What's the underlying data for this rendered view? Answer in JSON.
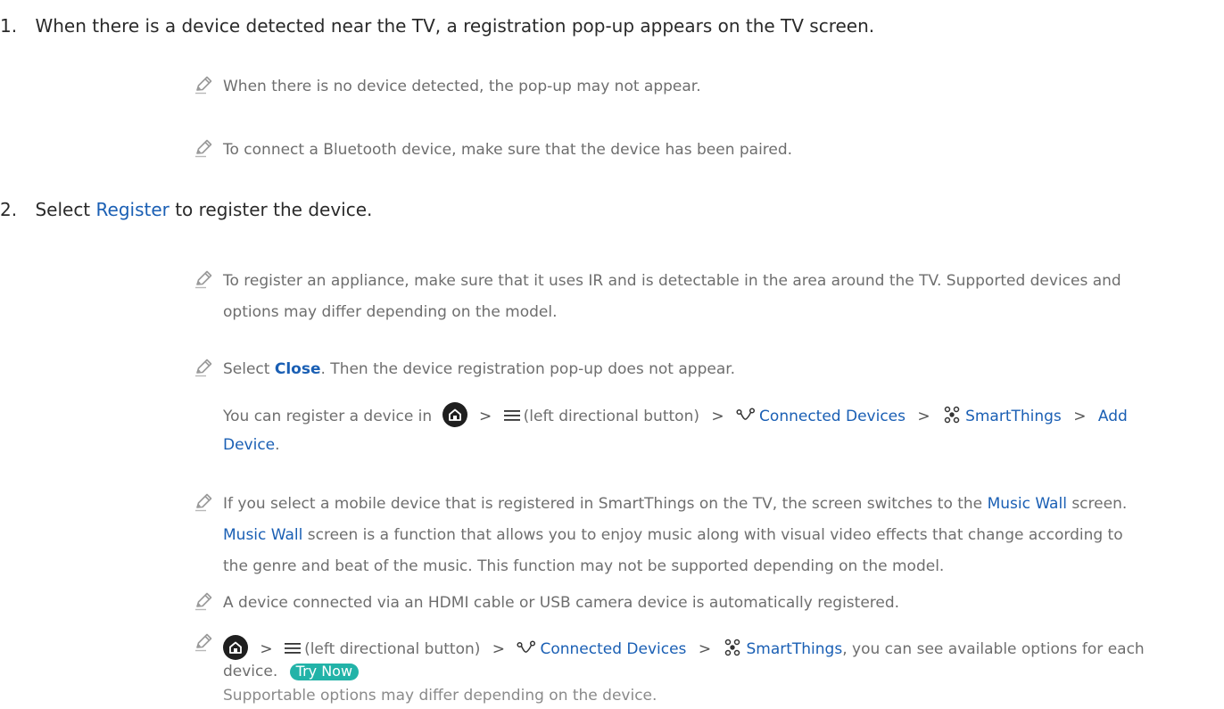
{
  "steps": [
    {
      "number": "1.",
      "text": "When there is a device detected near the TV, a registration pop-up appears on the TV screen."
    },
    {
      "number": "2.",
      "prefix": "Select ",
      "link": "Register",
      "suffix": " to register the device."
    }
  ],
  "step1_notes": [
    "When there is no device detected, the pop-up may not appear.",
    "To connect a Bluetooth device, make sure that the device has been paired."
  ],
  "step2_notes": {
    "appliance": [
      "To register an appliance, make sure that it uses IR and is detectable in the area around the TV. Supported devices and",
      "options may differ depending on the model."
    ],
    "close": {
      "prefix": "Select ",
      "bold": "Close",
      "suffix": ". Then the device registration pop-up does not appear."
    },
    "register_path": {
      "prefix": "You can register a device in",
      "menu_label": "(left directional button)",
      "connected": "Connected Devices",
      "smartthings": "SmartThings",
      "add": "Add",
      "device": "Device",
      "period": "."
    },
    "music_wall": {
      "l1_prefix": "If you select a mobile device that is registered in SmartThings on the TV, the screen switches to the ",
      "l1_link": "Music Wall",
      "l1_suffix": " screen.",
      "l2_link": "Music Wall",
      "l2_suffix": " screen is a function that allows you to enjoy music along with visual video effects that change according to",
      "l3": "the genre and beat of the music. This function may not be supported depending on the model."
    },
    "hdmi": "A device connected via an HDMI cable or USB camera device is automatically registered.",
    "options_path": {
      "menu_label": "(left directional button)",
      "connected": "Connected Devices",
      "smartthings": "SmartThings",
      "suffix": ", you can see available options for each",
      "l2": "device.",
      "try_now": "Try Now",
      "sub": "Supportable options may differ depending on the device."
    }
  },
  "icons": {
    "note": "pencil-icon",
    "home": "home-icon",
    "menu": "menu-icon",
    "connected": "connected-devices-icon",
    "smartthings": "smartthings-icon",
    "chevron": "chevron-right-icon"
  },
  "colors": {
    "link": "#1a5fb4",
    "try_now_bg": "#22b3a8",
    "text": "#333333",
    "note_text": "#6e6e6e"
  }
}
